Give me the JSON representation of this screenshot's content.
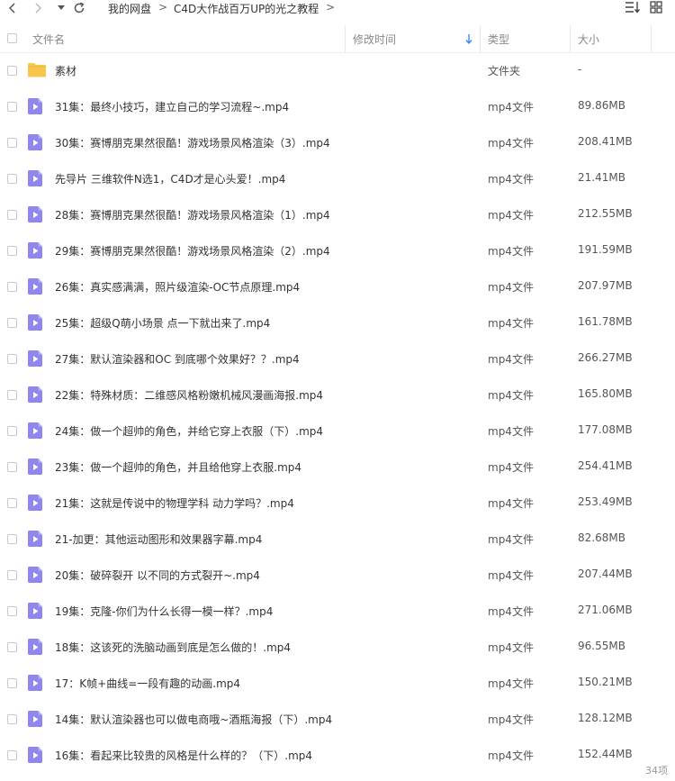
{
  "nav": {
    "breadcrumb": [
      "我的网盘",
      "C4D大作战百万UP的光之教程"
    ],
    "separator": ">"
  },
  "header": {
    "name": "文件名",
    "modified": "修改时间",
    "type": "类型",
    "size": "大小"
  },
  "rows": [
    {
      "icon": "folder-icon",
      "name": "素材",
      "type": "文件夹",
      "size": "-"
    },
    {
      "icon": "video-file-icon",
      "name": "31集：最终小技巧，建立自己的学习流程~.mp4",
      "type": "mp4文件",
      "size": "89.86MB"
    },
    {
      "icon": "video-file-icon",
      "name": "30集：赛博朋克果然很酷！游戏场景风格渲染（3）.mp4",
      "type": "mp4文件",
      "size": "208.41MB"
    },
    {
      "icon": "video-file-icon",
      "name": "先导片 三维软件N选1，C4D才是心头爱！.mp4",
      "type": "mp4文件",
      "size": "21.41MB"
    },
    {
      "icon": "video-file-icon",
      "name": "28集：赛博朋克果然很酷！游戏场景风格渲染（1）.mp4",
      "type": "mp4文件",
      "size": "212.55MB"
    },
    {
      "icon": "video-file-icon",
      "name": "29集：赛博朋克果然很酷！游戏场景风格渲染（2）.mp4",
      "type": "mp4文件",
      "size": "191.59MB"
    },
    {
      "icon": "video-file-icon",
      "name": "26集：真实感满满，照片级渲染-OC节点原理.mp4",
      "type": "mp4文件",
      "size": "207.97MB"
    },
    {
      "icon": "video-file-icon",
      "name": "25集：超级Q萌小场景 点一下就出来了.mp4",
      "type": "mp4文件",
      "size": "161.78MB"
    },
    {
      "icon": "video-file-icon",
      "name": "27集：默认渲染器和OC  到底哪个效果好？？.mp4",
      "type": "mp4文件",
      "size": "266.27MB"
    },
    {
      "icon": "video-file-icon",
      "name": "22集：特殊材质：二维感风格粉嫩机械风漫画海报.mp4",
      "type": "mp4文件",
      "size": "165.80MB"
    },
    {
      "icon": "video-file-icon",
      "name": "24集：做一个超帅的角色，并给它穿上衣服（下）.mp4",
      "type": "mp4文件",
      "size": "177.08MB"
    },
    {
      "icon": "video-file-icon",
      "name": "23集：做一个超帅的角色，并且给他穿上衣服.mp4",
      "type": "mp4文件",
      "size": "254.41MB"
    },
    {
      "icon": "video-file-icon",
      "name": "21集：这就是传说中的物理学科 动力学吗？.mp4",
      "type": "mp4文件",
      "size": "253.49MB"
    },
    {
      "icon": "video-file-icon",
      "name": "21-加更：其他运动图形和效果器字幕.mp4",
      "type": "mp4文件",
      "size": "82.68MB"
    },
    {
      "icon": "video-file-icon",
      "name": "20集：破碎裂开 以不同的方式裂开~.mp4",
      "type": "mp4文件",
      "size": "207.44MB"
    },
    {
      "icon": "video-file-icon",
      "name": "19集：克隆-你们为什么长得一模一样？.mp4",
      "type": "mp4文件",
      "size": "271.06MB"
    },
    {
      "icon": "video-file-icon",
      "name": "18集：这该死的洗脑动画到底是怎么做的！.mp4",
      "type": "mp4文件",
      "size": "96.55MB"
    },
    {
      "icon": "video-file-icon",
      "name": "17：K帧+曲线=一段有趣的动画.mp4",
      "type": "mp4文件",
      "size": "150.21MB"
    },
    {
      "icon": "video-file-icon",
      "name": "14集：默认渲染器也可以做电商哦~酒瓶海报（下）.mp4",
      "type": "mp4文件",
      "size": "128.12MB"
    },
    {
      "icon": "video-file-icon",
      "name": "16集：看起来比较贵的风格是什么样的？（下）.mp4",
      "type": "mp4文件",
      "size": "152.44MB"
    }
  ],
  "footer": {
    "count": "34项"
  },
  "colors": {
    "folder": "#f7c64a",
    "video": "#8f86f0",
    "sort_arrow": "#3a8ef6"
  }
}
